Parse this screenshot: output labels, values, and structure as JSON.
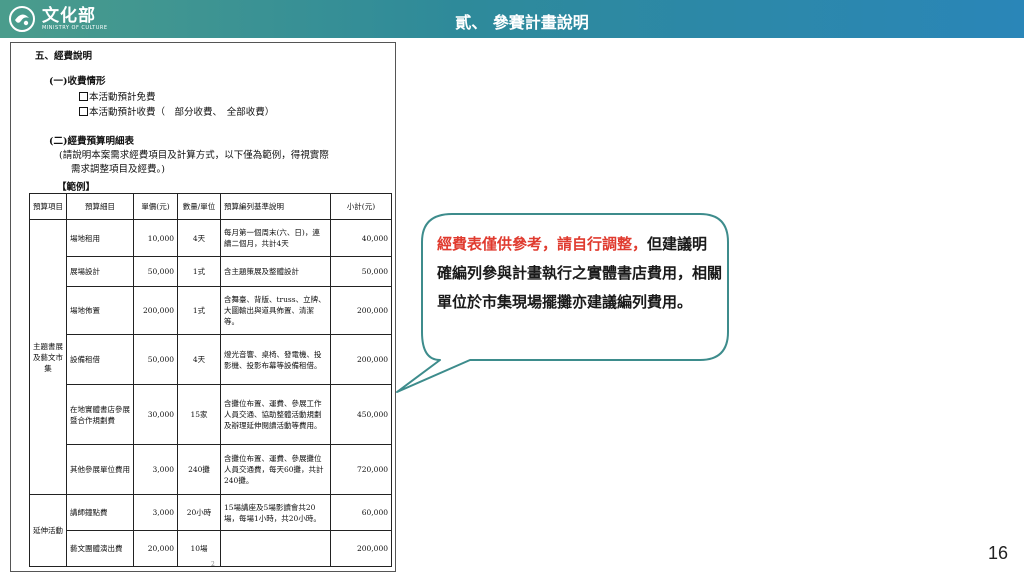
{
  "header": {
    "logo_main": "文化部",
    "logo_sub": "MINISTRY OF CULTURE",
    "title": "貳、 參賽計畫說明"
  },
  "doc": {
    "section_heading": "五、經費說明",
    "sub1_heading": "(一)收費情形",
    "option_free": "本活動預計免費",
    "option_paid": "本活動預計收費（　部分收費、　全部收費）",
    "sub2_heading": "(二)經費預算明細表",
    "instruction_line1": "(請說明本案需求經費項目及計算方式，以下僅為範例，得視實際",
    "instruction_line2": "需求調整項目及經費。)",
    "example_label": "【範例】",
    "table_headers": [
      "預算項目",
      "預算細目",
      "單價(元)",
      "數量/單位",
      "預算編列基準說明",
      "小計(元)"
    ],
    "groups": [
      {
        "name": "主題書展及藝文市集",
        "rows": [
          {
            "item": "場地租用",
            "unit_price": "10,000",
            "qty": "4天",
            "basis": "每月第一個周末(六、日)，連續二個月，共計4天",
            "subtotal": "40,000"
          },
          {
            "item": "展場設計",
            "unit_price": "50,000",
            "qty": "1式",
            "basis": "含主題策展及整體設計",
            "subtotal": "50,000"
          },
          {
            "item": "場地佈置",
            "unit_price": "200,000",
            "qty": "1式",
            "basis": "含舞臺、背版、truss、立牌、大圖輸出與道具佈置、清潔等。",
            "subtotal": "200,000"
          },
          {
            "item": "設備租借",
            "unit_price": "50,000",
            "qty": "4天",
            "basis": "燈光音響、桌椅、發電機、投影機、投影布幕等設備租借。",
            "subtotal": "200,000"
          },
          {
            "item": "在地實體書店參展暨合作規劃費",
            "unit_price": "30,000",
            "qty": "15家",
            "basis": "含攤位布置、運費、參展工作人員交通、協助整體活動規劃及辦理延伸閱讀活動等費用。",
            "subtotal": "450,000"
          },
          {
            "item": "其他參展單位費用",
            "unit_price": "3,000",
            "qty": "240攤",
            "basis": "含攤位布置、運費、參展攤位人員交通費，每天60攤，共計240攤。",
            "subtotal": "720,000"
          }
        ]
      },
      {
        "name": "延伸活動",
        "rows": [
          {
            "item": "講師鐘點費",
            "unit_price": "3,000",
            "qty": "20小時",
            "basis": "15場講座及5場影讀會共20場，每場1小時，共20小時。",
            "subtotal": "60,000"
          },
          {
            "item": "藝文團體演出費",
            "unit_price": "20,000",
            "qty": "10場",
            "basis": "",
            "subtotal": "200,000"
          }
        ]
      }
    ],
    "footer_mark": "2"
  },
  "callout": {
    "highlight": "經費表僅供參考，請自行調整，",
    "body": "但建議明確編列參與計畫執行之實體書店費用，相關單位於市集現場擺攤亦建議編列費用。"
  },
  "page_number": "16",
  "colors": {
    "header_start": "#4a9c8c",
    "header_end": "#2a86b8",
    "callout_border": "#3d8c8c",
    "highlight_text": "#e03b2f"
  }
}
